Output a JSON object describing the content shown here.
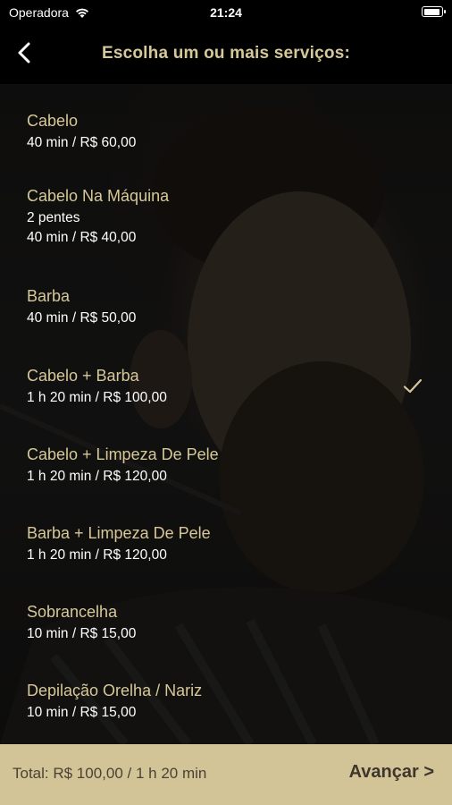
{
  "status_bar": {
    "carrier": "Operadora",
    "time": "21:24"
  },
  "nav": {
    "title": "Escolha um ou mais serviços:"
  },
  "services": [
    {
      "name": "Cabelo",
      "extra": "",
      "detail": "40 min / R$ 60,00",
      "selected": false
    },
    {
      "name": "Cabelo Na Máquina",
      "extra": "2 pentes",
      "detail": "40 min / R$ 40,00",
      "selected": false
    },
    {
      "name": "Barba",
      "extra": "",
      "detail": "40 min / R$ 50,00",
      "selected": false
    },
    {
      "name": "Cabelo + Barba",
      "extra": "",
      "detail": "1 h 20 min / R$ 100,00",
      "selected": true
    },
    {
      "name": "Cabelo + Limpeza De Pele",
      "extra": "",
      "detail": "1 h 20 min / R$ 120,00",
      "selected": false
    },
    {
      "name": "Barba + Limpeza De Pele",
      "extra": "",
      "detail": "1 h 20 min / R$ 120,00",
      "selected": false
    },
    {
      "name": "Sobrancelha",
      "extra": "",
      "detail": "10 min / R$ 15,00",
      "selected": false
    },
    {
      "name": "Depilação Orelha / Nariz",
      "extra": "",
      "detail": "10 min / R$ 15,00",
      "selected": false
    }
  ],
  "footer": {
    "total": "Total: R$ 100,00 / 1 h 20 min",
    "next_label": "Avançar >"
  },
  "colors": {
    "accent": "#d6c899",
    "footer_bg": "#d3c498",
    "footer_text": "#4a4233"
  }
}
